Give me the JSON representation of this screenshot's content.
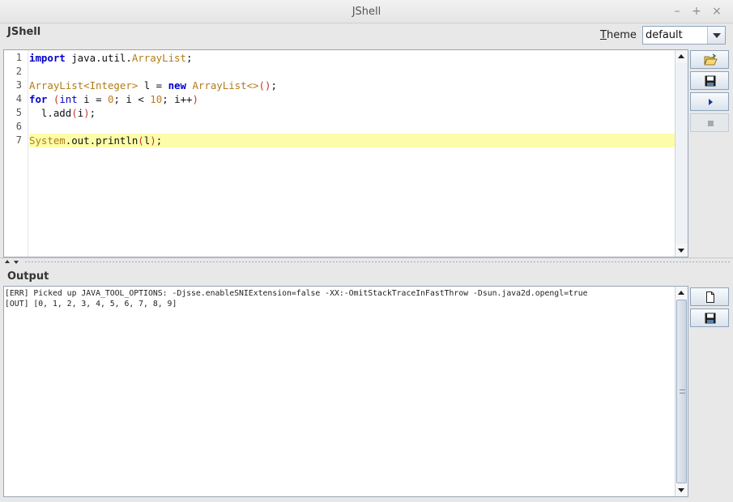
{
  "window": {
    "title": "JShell"
  },
  "header": {
    "title": "JShell",
    "theme_label_first": "T",
    "theme_label_rest": "heme",
    "theme_value": "default"
  },
  "editor": {
    "line_numbers": [
      "1",
      "2",
      "3",
      "4",
      "5",
      "6",
      "7"
    ],
    "lines": [
      [
        {
          "t": "import",
          "c": "kw"
        },
        {
          "t": " java.util.",
          "c": "pl"
        },
        {
          "t": "ArrayList",
          "c": "ty"
        },
        {
          "t": ";",
          "c": "pl"
        }
      ],
      [],
      [
        {
          "t": "ArrayList<Integer>",
          "c": "ty"
        },
        {
          "t": " l = ",
          "c": "pl"
        },
        {
          "t": "new",
          "c": "kw"
        },
        {
          "t": " ",
          "c": "pl"
        },
        {
          "t": "ArrayList<>",
          "c": "ty"
        },
        {
          "t": "()",
          "c": "pa"
        },
        {
          "t": ";",
          "c": "pl"
        }
      ],
      [
        {
          "t": "for",
          "c": "kw"
        },
        {
          "t": " ",
          "c": "pl"
        },
        {
          "t": "(",
          "c": "pa"
        },
        {
          "t": "int",
          "c": "kw2"
        },
        {
          "t": " i = ",
          "c": "pl"
        },
        {
          "t": "0",
          "c": "num"
        },
        {
          "t": "; i < ",
          "c": "pl"
        },
        {
          "t": "10",
          "c": "num"
        },
        {
          "t": "; i++",
          "c": "pl"
        },
        {
          "t": ")",
          "c": "pa"
        }
      ],
      [
        {
          "t": "  l.add",
          "c": "pl"
        },
        {
          "t": "(",
          "c": "pa"
        },
        {
          "t": "i",
          "c": "pl"
        },
        {
          "t": ")",
          "c": "pa"
        },
        {
          "t": ";",
          "c": "pl"
        }
      ],
      [],
      [
        {
          "t": "System",
          "c": "ty"
        },
        {
          "t": ".out.println",
          "c": "pl"
        },
        {
          "t": "(",
          "c": "pa"
        },
        {
          "t": "l",
          "c": "pl"
        },
        {
          "t": ")",
          "c": "pa"
        },
        {
          "t": ";",
          "c": "pl"
        }
      ]
    ],
    "highlighted_line": 7
  },
  "toolbar": {
    "buttons": [
      {
        "name": "open-button",
        "icon": "open-folder-icon",
        "enabled": true
      },
      {
        "name": "save-button",
        "icon": "floppy-disk-icon",
        "enabled": true
      },
      {
        "name": "run-button",
        "icon": "play-icon",
        "enabled": true
      },
      {
        "name": "stop-button",
        "icon": "stop-icon",
        "enabled": false
      }
    ]
  },
  "output": {
    "title": "Output",
    "lines": [
      "[ERR] Picked up JAVA_TOOL_OPTIONS: -Djsse.enableSNIExtension=false -XX:-OmitStackTraceInFastThrow -Dsun.java2d.opengl=true",
      "[OUT] [0, 1, 2, 3, 4, 5, 6, 7, 8, 9]"
    ],
    "buttons": [
      {
        "name": "clear-output-button",
        "icon": "new-document-icon"
      },
      {
        "name": "save-output-button",
        "icon": "floppy-disk-icon"
      }
    ]
  },
  "colors": {
    "keyword": "#0000cc",
    "type": "#b07d1a",
    "paren": "#cc3333",
    "current_line": "#fdfda9"
  }
}
